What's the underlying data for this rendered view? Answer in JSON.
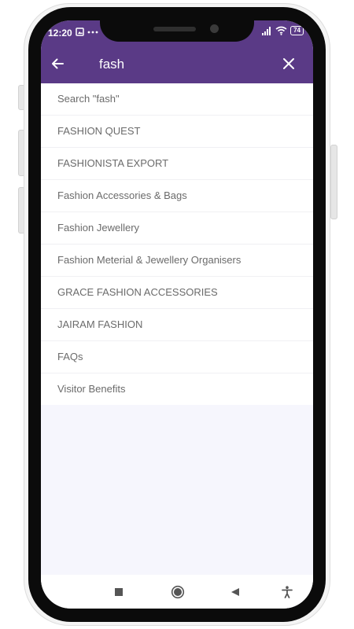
{
  "status_bar": {
    "time": "12:20",
    "notification_icons": [
      "image-notification-icon",
      "more-dots-icon"
    ],
    "signal_icons": [
      "signal-icon",
      "wifi-icon"
    ],
    "battery_level": "74"
  },
  "search_bar": {
    "query": "fash",
    "back_icon": "arrow-left-icon",
    "clear_icon": "close-icon"
  },
  "suggestions": [
    "Search \"fash\"",
    "FASHION QUEST",
    "FASHIONISTA EXPORT",
    "Fashion Accessories & Bags",
    "Fashion Jewellery",
    "Fashion Meterial & Jewellery Organisers",
    "GRACE FASHION ACCESSORIES",
    "JAIRAM FASHION",
    "FAQs",
    "Visitor Benefits"
  ],
  "nav_bar": {
    "icons": [
      "recents-square-icon",
      "home-circle-icon",
      "back-triangle-icon",
      "accessibility-icon"
    ]
  },
  "colors": {
    "app_bar": "#5a3a86",
    "screen_background": "#f6f6fd",
    "suggestion_text": "#6b6b6b"
  }
}
